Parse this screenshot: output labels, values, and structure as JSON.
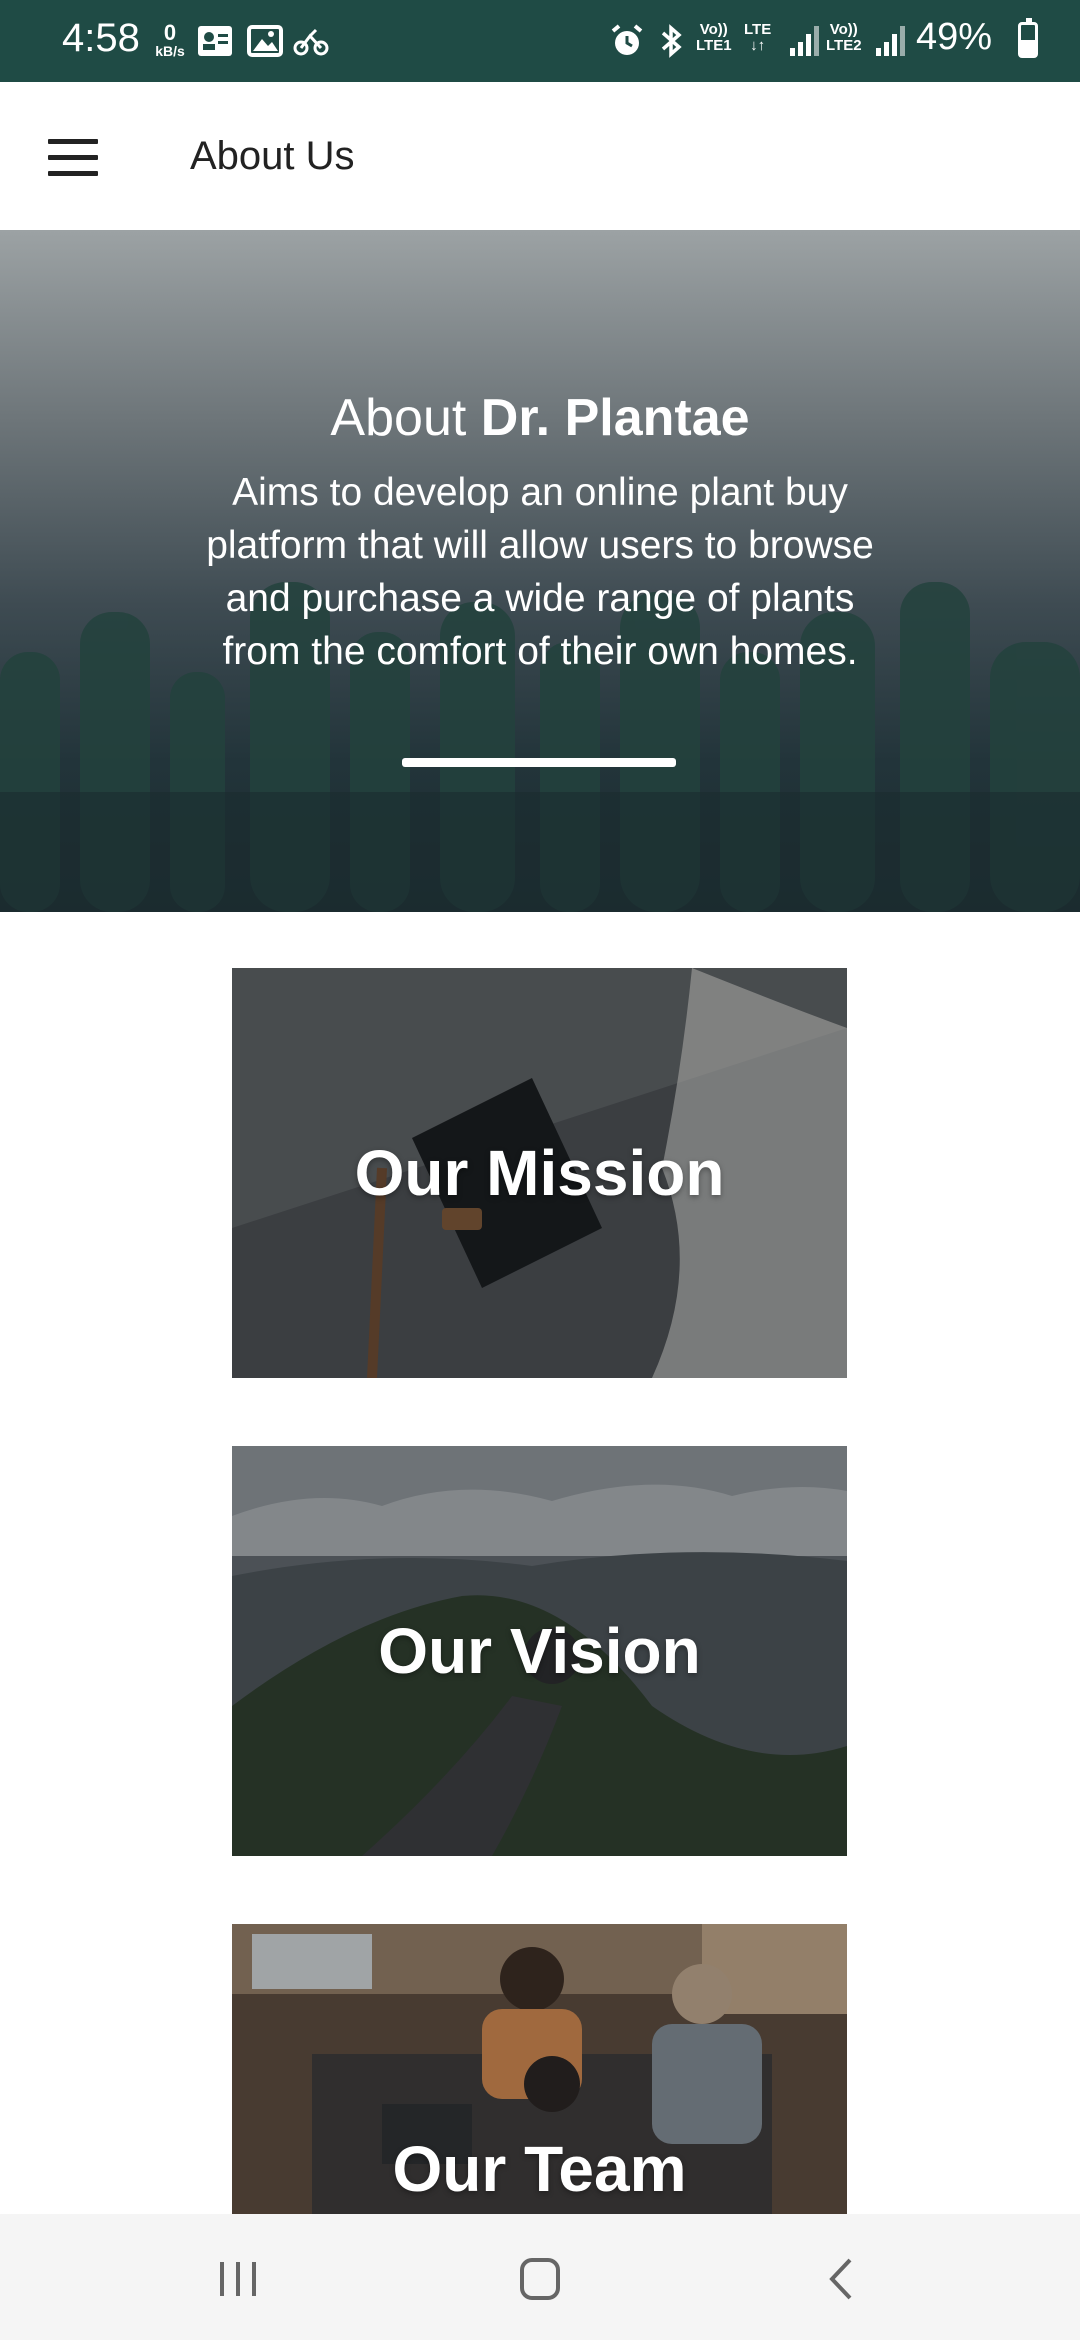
{
  "status_bar": {
    "time": "4:58",
    "data_speed_value": "0",
    "data_speed_unit": "kB/s",
    "volte1": "Vo))",
    "lte1": "LTE1",
    "lte_label": "LTE",
    "volte2": "Vo))",
    "lte2": "LTE2",
    "battery": "49%",
    "battery_level": 0.49
  },
  "app_bar": {
    "title": "About Us",
    "menu_icon": "hamburger-menu-icon"
  },
  "hero": {
    "title_prefix": "About ",
    "title_brand": "Dr. Plantae",
    "description": "Aims to develop an online plant buy platform that will allow users to browse and purchase a wide range of plants from the comfort of their own homes."
  },
  "cards": [
    {
      "title": "Our Mission"
    },
    {
      "title": "Our Vision"
    },
    {
      "title": "Our Team"
    }
  ],
  "nav_bar": {
    "icons": [
      "recent-apps-icon",
      "home-icon",
      "back-icon"
    ]
  },
  "colors": {
    "status_bar_bg": "#1f4b45",
    "app_bar_bg": "#ffffff",
    "text_dark": "#222222"
  }
}
